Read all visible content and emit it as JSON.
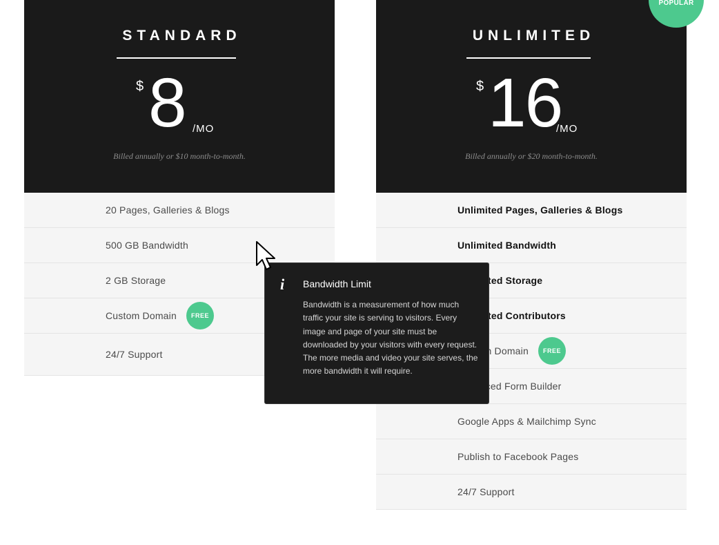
{
  "plans": {
    "standard": {
      "title": "STANDARD",
      "currency": "$",
      "amount": "8",
      "per": "/MO",
      "billing": "Billed annually or $10 month-to-month.",
      "features": [
        {
          "label": "20 Pages, Galleries & Blogs"
        },
        {
          "label": "500 GB Bandwidth"
        },
        {
          "label": "2 GB Storage"
        },
        {
          "label": "Custom Domain",
          "badge": "FREE"
        },
        {
          "label": "24/7 Support"
        }
      ]
    },
    "unlimited": {
      "title": "UNLIMITED",
      "badge": "POPULAR",
      "currency": "$",
      "amount": "16",
      "per": "/MO",
      "billing": "Billed annually or $20 month-to-month.",
      "features": [
        {
          "label": "Unlimited Pages, Galleries & Blogs"
        },
        {
          "label": "Unlimited Bandwidth"
        },
        {
          "label": "Unlimited Storage"
        },
        {
          "label": "Unlimited Contributors"
        },
        {
          "label": "Custom Domain",
          "badge": "FREE"
        },
        {
          "label": "Advanced Form Builder"
        },
        {
          "label": "Google Apps & Mailchimp Sync"
        },
        {
          "label": "Publish to Facebook Pages"
        },
        {
          "label": "24/7 Support"
        }
      ]
    }
  },
  "tooltip": {
    "icon": "info-icon",
    "icon_glyph": "i",
    "title": "Bandwidth Limit",
    "body": "Bandwidth is a measurement of how much traffic your site is serving to visitors. Every image and page of your site must be downloaded by your visitors with every request. The more media and video your site serves, the more bandwidth it will require."
  },
  "colors": {
    "header_bg": "#1a1a1a",
    "feature_bg": "#f5f5f5",
    "accent_green": "#4dc98e"
  }
}
